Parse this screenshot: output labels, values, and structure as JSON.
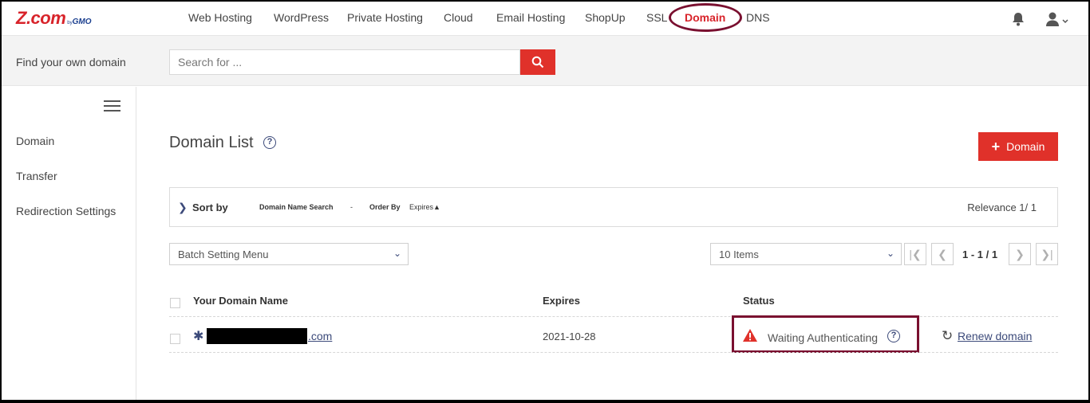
{
  "brand": {
    "logo_main": "Z.com",
    "logo_by": "by",
    "logo_gmo": "GMO"
  },
  "nav": {
    "items": [
      {
        "label": "Web Hosting"
      },
      {
        "label": "WordPress"
      },
      {
        "label": "Private Hosting"
      },
      {
        "label": "Cloud"
      },
      {
        "label": "Email Hosting"
      },
      {
        "label": "ShopUp"
      },
      {
        "label": "SSL"
      },
      {
        "label": "Domain",
        "active": true
      },
      {
        "label": "DNS"
      }
    ],
    "icons": [
      "bell-icon",
      "user-icon",
      "chevron-down-icon"
    ]
  },
  "search": {
    "label": "Find your own domain",
    "placeholder": "Search for ..."
  },
  "sidebar": {
    "items": [
      {
        "label": "Domain"
      },
      {
        "label": "Transfer"
      },
      {
        "label": "Redirection Settings"
      }
    ]
  },
  "main": {
    "title": "Domain List",
    "help_glyph": "?",
    "add_button_label": "Domain",
    "sort": {
      "label": "Sort by",
      "domain_search_label": "Domain Name Search",
      "dash": "-",
      "order_by_label": "Order By",
      "order_by_value": "Expires▲",
      "relevance": "Relevance 1/ 1"
    },
    "batch_menu": "Batch Setting Menu",
    "per_page": "10 Items",
    "pager_text": "1 - 1 / 1",
    "pager_glyphs": {
      "first": "|❮",
      "prev": "❮",
      "next": "❯",
      "last": "❯|"
    },
    "table": {
      "headers": {
        "domain": "Your Domain Name",
        "expires": "Expires",
        "status": "Status"
      },
      "rows": [
        {
          "domain_suffix": ".com",
          "expires": "2021-10-28",
          "status": "Waiting Authenticating",
          "action": "Renew domain"
        }
      ]
    }
  },
  "colors": {
    "brand_red": "#e0312a",
    "navy": "#3c4a7a",
    "highlight": "#7a1030"
  }
}
